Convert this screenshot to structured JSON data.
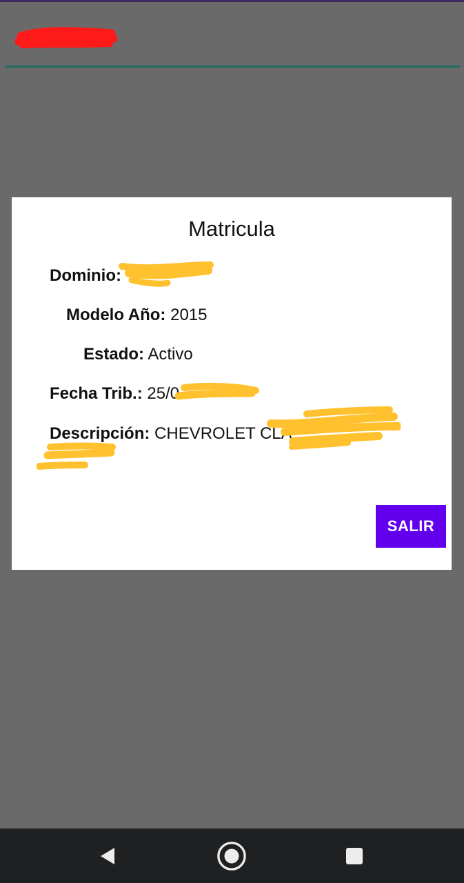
{
  "header": {
    "title": ""
  },
  "dialog": {
    "title": "Matricula",
    "fields": [
      {
        "label": "Dominio:",
        "value": ""
      },
      {
        "label": "Modelo Año:",
        "value": "2015"
      },
      {
        "label": "Estado:",
        "value": "Activo"
      },
      {
        "label": "Fecha Trib.:",
        "value": "25/0"
      },
      {
        "label": "Descripción:",
        "value": "CHEVROLET CLA"
      }
    ],
    "exit_button": "SALIR"
  },
  "colors": {
    "overlay": "#6a6a6a",
    "dialog_bg": "#ffffff",
    "accent": "#6200ee",
    "divider": "#1f6b62",
    "redaction_red": "#ff1a1a",
    "redaction_yellow": "#ffc12e",
    "navbar": "#1e2022"
  },
  "navbar": {
    "icons": [
      "back-icon",
      "home-icon",
      "recents-icon"
    ]
  }
}
